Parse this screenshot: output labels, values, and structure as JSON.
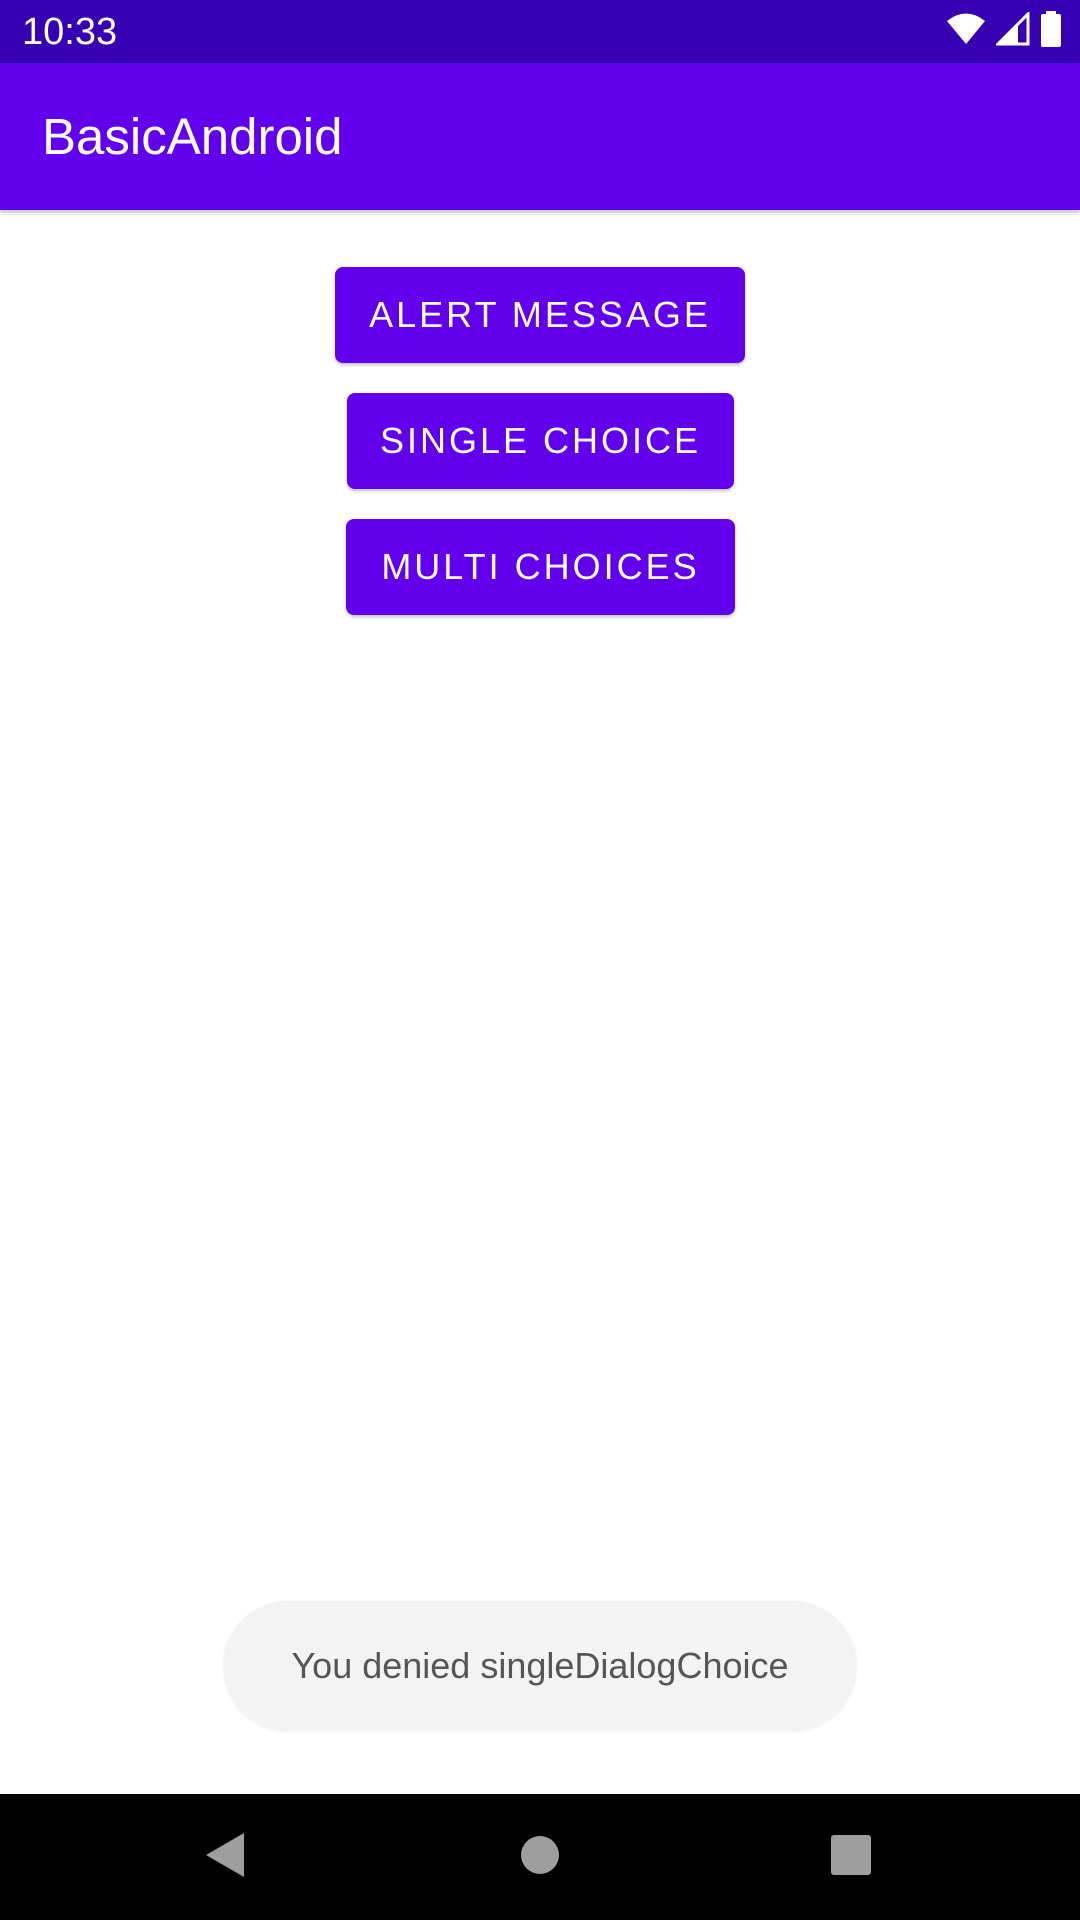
{
  "status_bar": {
    "time": "10:33",
    "icons": [
      "wifi-icon",
      "signal-icon",
      "battery-icon"
    ]
  },
  "app_bar": {
    "title": "BasicAndroid"
  },
  "buttons": [
    {
      "label": "ALERT MESSAGE"
    },
    {
      "label": "SINGLE CHOICE"
    },
    {
      "label": "MULTI CHOICES"
    }
  ],
  "toast": {
    "message": "You denied singleDialogChoice"
  },
  "nav_bar": {
    "icons": [
      "back-icon",
      "home-icon",
      "recents-icon"
    ]
  },
  "colors": {
    "status_bar": "#3700B3",
    "primary": "#6200EE",
    "toast_bg": "#F3F3F3"
  }
}
